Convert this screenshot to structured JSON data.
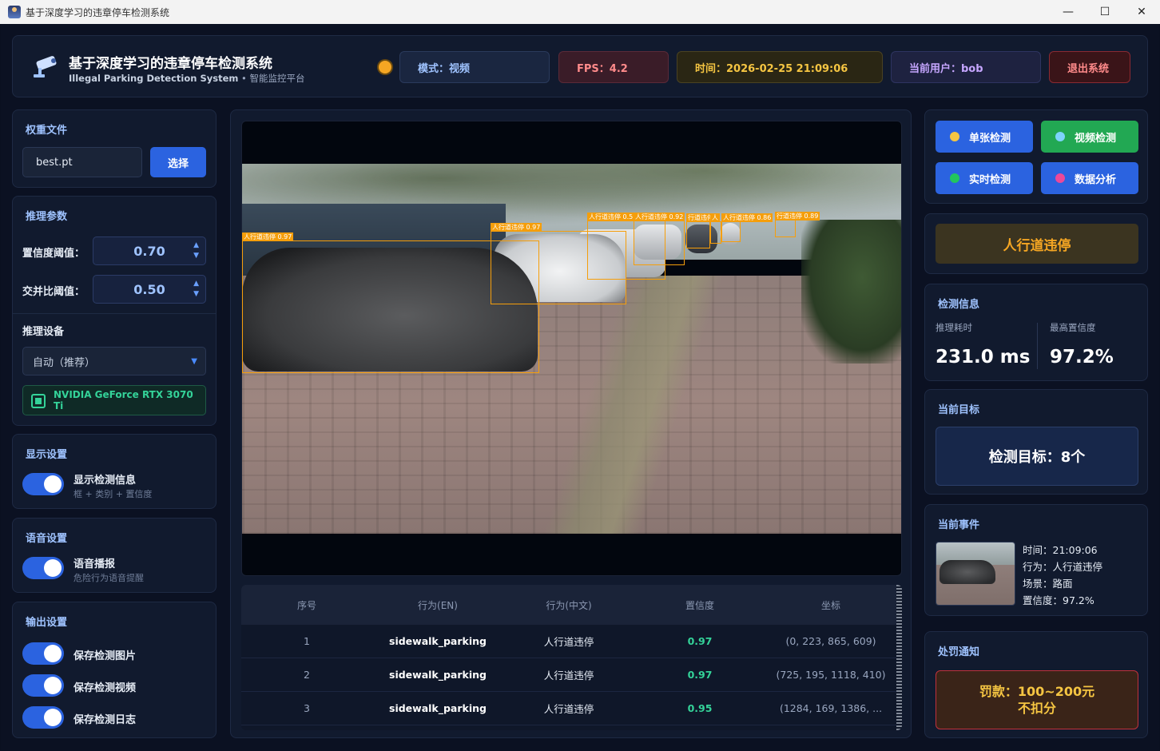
{
  "window": {
    "title": "基于深度学习的违章停车检测系统",
    "minimize_glyph": "—",
    "maximize_glyph": "☐",
    "close_glyph": "✕"
  },
  "header": {
    "title": "基于深度学习的违章停车检测系统",
    "subtitle_en": "Illegal Parking Detection System",
    "subtitle_cn": " • 智能监控平台",
    "mode": "模式：视频",
    "fps": "FPS：4.2",
    "time": "时间：2026-02-25 21:09:06",
    "user": "当前用户：bob",
    "exit": "退出系统",
    "status_color": "#f5a623"
  },
  "weights": {
    "title": "权重文件",
    "file": "best.pt",
    "select_label": "选择"
  },
  "inference": {
    "title": "推理参数",
    "conf_label": "置信度阈值：",
    "conf_value": "0.70",
    "iou_label": "交并比阈值：",
    "iou_value": "0.50",
    "device_label": "推理设备",
    "device_value": "自动（推荐）",
    "gpu": "NVIDIA GeForce RTX 3070 Ti"
  },
  "display": {
    "title": "显示设置",
    "toggle_label": "显示检测信息",
    "toggle_sub": "框 + 类别 + 置信度",
    "enabled": true
  },
  "voice": {
    "title": "语音设置",
    "toggle_label": "语音播报",
    "toggle_sub": "危险行为语音提醒",
    "enabled": true
  },
  "output": {
    "title": "输出设置",
    "items": [
      {
        "label": "保存检测图片",
        "enabled": true
      },
      {
        "label": "保存检测视频",
        "enabled": true
      },
      {
        "label": "保存检测日志",
        "enabled": true
      }
    ]
  },
  "video": {
    "detections": [
      {
        "label": "人行道违停 0.97"
      },
      {
        "label": "人行道违停 0.97"
      },
      {
        "label": "人行道违停 0.5"
      },
      {
        "label": "人行道违停 0.92"
      },
      {
        "label": "行道违停"
      },
      {
        "label": "人"
      },
      {
        "label": "人行道违停 0.86"
      },
      {
        "label": "行道违停 0.89"
      }
    ]
  },
  "table": {
    "headers": [
      "序号",
      "行为(EN)",
      "行为(中文)",
      "置信度",
      "坐标"
    ],
    "rows": [
      {
        "idx": "1",
        "en": "sidewalk_parking",
        "cn": "人行道违停",
        "conf": "0.97",
        "coords": "(0, 223, 865, 609)"
      },
      {
        "idx": "2",
        "en": "sidewalk_parking",
        "cn": "人行道违停",
        "conf": "0.97",
        "coords": "(725, 195, 1118, 410)"
      },
      {
        "idx": "3",
        "en": "sidewalk_parking",
        "cn": "人行道违停",
        "conf": "0.95",
        "coords": "(1284, 169, 1386, ..."
      }
    ]
  },
  "modes": {
    "single": {
      "label": "单张检测",
      "dot_color": "#f5c542"
    },
    "video": {
      "label": "视频检测",
      "dot_color": "#7dd3fc"
    },
    "live": {
      "label": "实时检测",
      "dot_color": "#22c55e"
    },
    "data": {
      "label": "数据分析",
      "dot_color": "#ec4899"
    }
  },
  "current_violation": "人行道违停",
  "detection_info": {
    "title": "检测信息",
    "time_label": "推理耗时",
    "time_value": "231.0 ms",
    "conf_label": "最高置信度",
    "conf_value": "97.2%"
  },
  "current_target": {
    "title": "当前目标",
    "text": "检测目标：8个"
  },
  "current_event": {
    "title": "当前事件",
    "time": "时间：21:09:06",
    "behavior": "行为：人行道违停",
    "scene": "场景：路面",
    "confidence": "置信度：97.2%"
  },
  "penalty": {
    "title": "处罚通知",
    "line1": "罚款：100~200元",
    "line2": "不扣分"
  }
}
